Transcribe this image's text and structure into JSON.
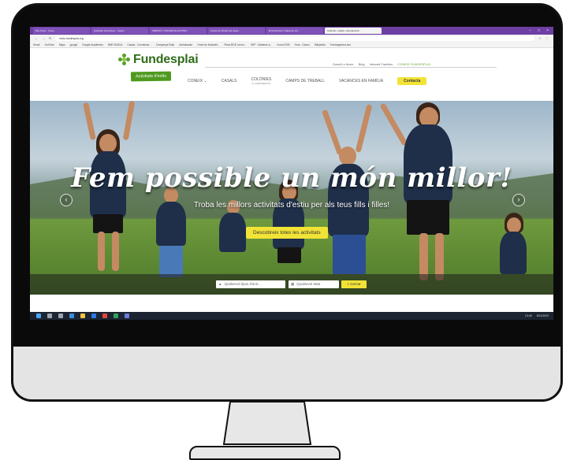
{
  "browser": {
    "tabs": [
      "Mis Ardeu - Casa...",
      "Activitats educatives - Cases",
      "VERSIÓ 1. PROJECTE AUTORI...",
      "Gestió de difusió del casal...",
      "El Dinamitzar | Mapa de Act...",
      "Colònies, casals, campaments..."
    ],
    "url": "estiu.fundesplai.org",
    "bookmarks": [
      "Gmail",
      "YouTube",
      "Maps",
      "google",
      "Google Académico",
      "BNE BUSCA",
      "Casals - Coordinaci...",
      "Campanya Estiu",
      "Ambaixador",
      "Ordre de Naturalit...",
      "Plans BOE Lenes...",
      "SEP - Mantenir a...",
      "Curso ESIS",
      "Hora - Gaveu",
      "Wikipedia",
      "Fomixagenera.bcn"
    ]
  },
  "site": {
    "logo_text": "Fundesplai",
    "logo_badge": "Activitats d'estiu",
    "toplinks": [
      "Suma't a lleure",
      "Blog",
      "Intranet Families"
    ],
    "toplink_accent": "CONEIX FUNDESPLAI",
    "nav": {
      "coneix": "CONEIX",
      "casals": "CASALS",
      "colonies": "COLÒNIES",
      "colonies_sub": "& CAMPAMENTS",
      "camps": "CAMPS DE TREBALL",
      "vacances": "VACANCES EN FAMÍLIA",
      "contact": "Contacta"
    }
  },
  "hero": {
    "title": "Fem possible un món millor!",
    "subtitle": "Troba les millors activitats d'estiu per als teus fills i filles!",
    "cta": "Descobreix totes les activitats",
    "search_type_placeholder": "Qualsevol tipus d'acti...",
    "search_date_placeholder": "Qualsevol data",
    "search_button": "Cercar"
  },
  "taskbar": {
    "time": "13:45",
    "date": "8/11/2023"
  },
  "colors": {
    "accent_yellow": "#f2e337",
    "brand_green": "#4e9a1f",
    "browser_purple": "#6d3fa3"
  }
}
